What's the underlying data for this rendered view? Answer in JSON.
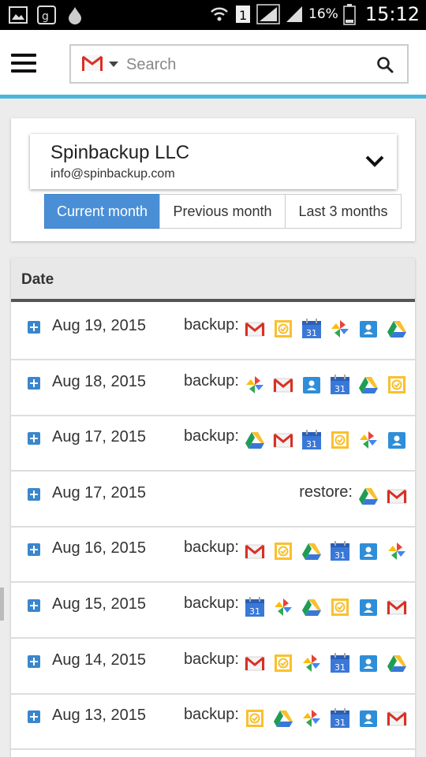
{
  "status_bar": {
    "battery_percent": "16%",
    "time": "15:12",
    "sim_slot": "1"
  },
  "search": {
    "placeholder": "Search"
  },
  "account": {
    "name": "Spinbackup LLC",
    "email": "info@spinbackup.com"
  },
  "period_tabs": [
    {
      "label": "Current month",
      "active": true
    },
    {
      "label": "Previous month",
      "active": false
    },
    {
      "label": "Last 3 months",
      "active": false
    }
  ],
  "table": {
    "header": "Date",
    "rows": [
      {
        "date": "Aug 19, 2015",
        "action": "backup:",
        "services": [
          "gmail-icon",
          "tasks-icon",
          "calendar-icon",
          "photos-icon",
          "contacts-icon",
          "drive-icon"
        ]
      },
      {
        "date": "Aug 18, 2015",
        "action": "backup:",
        "services": [
          "photos-icon",
          "gmail-icon",
          "contacts-icon",
          "calendar-icon",
          "drive-icon",
          "tasks-icon"
        ]
      },
      {
        "date": "Aug 17, 2015",
        "action": "backup:",
        "services": [
          "drive-icon",
          "gmail-icon",
          "calendar-icon",
          "tasks-icon",
          "photos-icon",
          "contacts-icon"
        ]
      },
      {
        "date": "Aug 17, 2015",
        "action": "restore:",
        "services": [
          "drive-icon",
          "gmail-icon"
        ]
      },
      {
        "date": "Aug 16, 2015",
        "action": "backup:",
        "services": [
          "gmail-icon",
          "tasks-icon",
          "drive-icon",
          "calendar-icon",
          "contacts-icon",
          "photos-icon"
        ]
      },
      {
        "date": "Aug 15, 2015",
        "action": "backup:",
        "services": [
          "calendar-icon",
          "photos-icon",
          "drive-icon",
          "tasks-icon",
          "contacts-icon",
          "gmail-icon"
        ]
      },
      {
        "date": "Aug 14, 2015",
        "action": "backup:",
        "services": [
          "gmail-icon",
          "tasks-icon",
          "photos-icon",
          "calendar-icon",
          "contacts-icon",
          "drive-icon"
        ]
      },
      {
        "date": "Aug 13, 2015",
        "action": "backup:",
        "services": [
          "tasks-icon",
          "drive-icon",
          "photos-icon",
          "calendar-icon",
          "contacts-icon",
          "gmail-icon"
        ]
      }
    ]
  },
  "calendar_icon_text": "31",
  "colors": {
    "accent_line": "#49b6dc",
    "active_tab": "#4a8fd6",
    "plus_icon": "#3a86cc"
  }
}
